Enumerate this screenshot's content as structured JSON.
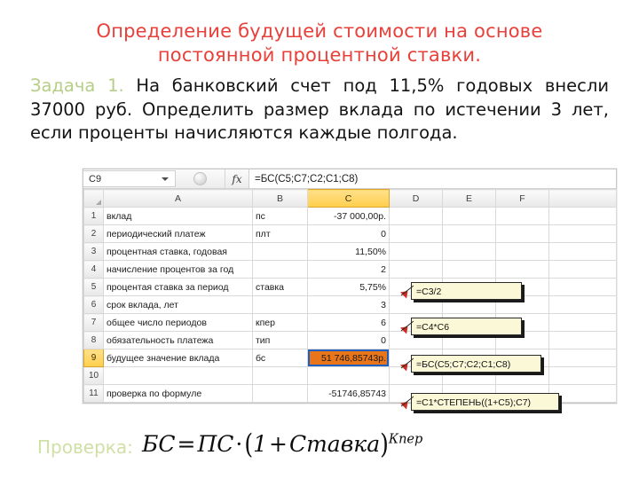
{
  "slide": {
    "title_line1": "Определение будущей стоимости на основе",
    "title_line2": "постоянной процентной ставки.",
    "title_color": "#e8403a",
    "task_label": "Задача 1.",
    "task_text": " На банковский счет под 11,5% годовых внесли 37000 руб. Определить размер вклада по истечении 3 лет, если проценты начисляются каждые полгода.",
    "check_label": "Проверка:"
  },
  "excel": {
    "name_box_value": "C9",
    "formula_bar_value": "=БС(C5;C7;C2;C1;C8)",
    "fx_label": "fx",
    "column_headers": [
      "A",
      "B",
      "C",
      "D",
      "E",
      "F"
    ],
    "selected_column": "C",
    "selected_row": "9",
    "rows": [
      {
        "num": "1",
        "a": "вклад",
        "b": "пс",
        "c": "-37 000,00р."
      },
      {
        "num": "2",
        "a": "периодический платеж",
        "b": "плт",
        "c": "0"
      },
      {
        "num": "3",
        "a": "процентная ставка, годовая",
        "b": "",
        "c": "11,50%"
      },
      {
        "num": "4",
        "a": "начисление процентов за год",
        "b": "",
        "c": "2"
      },
      {
        "num": "5",
        "a": "процентая ставка за период",
        "b": "ставка",
        "c": "5,75%"
      },
      {
        "num": "6",
        "a": "срок вклада, лет",
        "b": "",
        "c": "3"
      },
      {
        "num": "7",
        "a": "общее число периодов",
        "b": "кпер",
        "c": "6"
      },
      {
        "num": "8",
        "a": "обязательность платежа",
        "b": "тип",
        "c": "0"
      },
      {
        "num": "9",
        "a": "будущее значение вклада",
        "b": "бс",
        "c": "51 746,85743р."
      },
      {
        "num": "10",
        "a": "",
        "b": "",
        "c": ""
      },
      {
        "num": "11",
        "a": "проверка по формуле",
        "b": "",
        "c": "-51746,85743"
      }
    ]
  },
  "callouts": [
    {
      "id": "co1",
      "text": "=C3/2"
    },
    {
      "id": "co2",
      "text": "=C4*C6"
    },
    {
      "id": "co3",
      "text": "=БС(C5;C7;C2;C1;C8)"
    },
    {
      "id": "co4",
      "text": "=C1*СТЕПЕНЬ((1+C5);C7)"
    }
  ],
  "math_formula": {
    "lhs": "БС",
    "eq": "=",
    "pv": "ПС",
    "dot": "·",
    "open": "(",
    "one": "1",
    "plus": "+",
    "rate": "Ставка",
    "close": ")",
    "exponent": "Кпер"
  }
}
